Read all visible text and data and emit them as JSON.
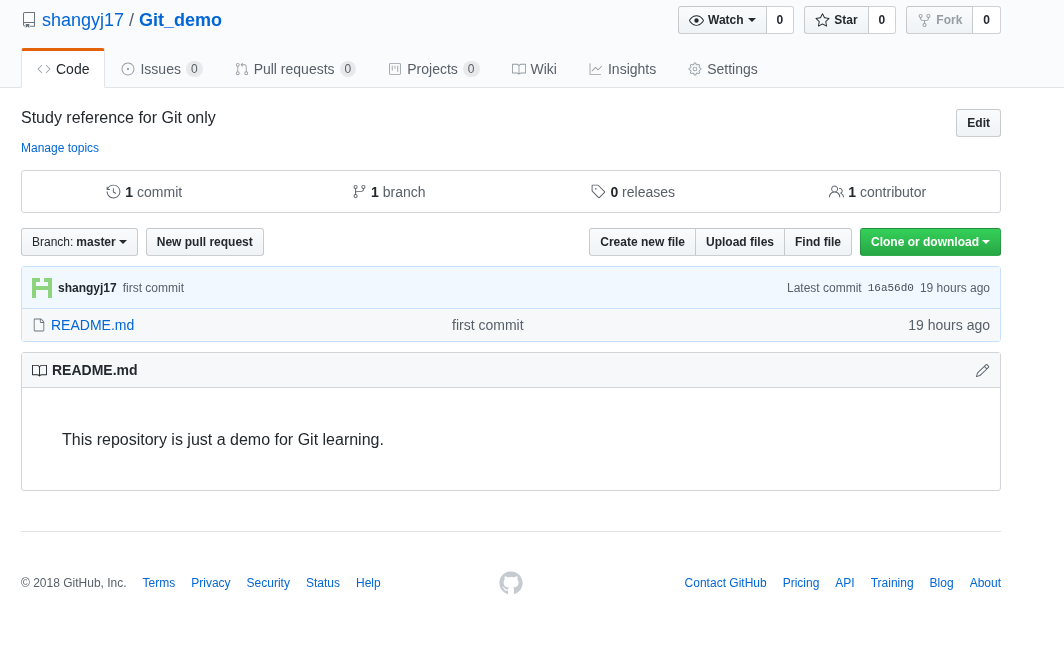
{
  "repo": {
    "owner": "shangyj17",
    "separator": "/",
    "name": "Git_demo"
  },
  "actions": [
    {
      "label": "Watch",
      "count": "0",
      "disabled": false,
      "caret": true
    },
    {
      "label": "Star",
      "count": "0",
      "disabled": false,
      "caret": false
    },
    {
      "label": "Fork",
      "count": "0",
      "disabled": true,
      "caret": false
    }
  ],
  "tabs": [
    {
      "label": "Code",
      "selected": true
    },
    {
      "label": "Issues",
      "count": "0",
      "selected": false
    },
    {
      "label": "Pull requests",
      "count": "0",
      "selected": false
    },
    {
      "label": "Projects",
      "count": "0",
      "selected": false
    },
    {
      "label": "Wiki",
      "selected": false
    },
    {
      "label": "Insights",
      "selected": false
    },
    {
      "label": "Settings",
      "selected": false
    }
  ],
  "description": "Study reference for Git only",
  "edit_button": "Edit",
  "manage_topics": "Manage topics",
  "stats": [
    "**1** commit",
    "**1** branch",
    "**0** releases",
    "**1** contributor"
  ],
  "branch_button": {
    "prefix": "Branch:",
    "branch": "master"
  },
  "new_pull_request": "New pull request",
  "file_buttons": [
    "Create new file",
    "Upload files",
    "Find file"
  ],
  "clone_button": "Clone or download",
  "commit": {
    "author": "shangyj17",
    "message": "first commit",
    "latest_label": "Latest commit",
    "sha": "16a56d0",
    "time": "19 hours ago"
  },
  "files": [
    {
      "name": "README.md",
      "message": "first commit",
      "time": "19 hours ago"
    }
  ],
  "readme": {
    "title": "README.md",
    "body": "This repository is just a demo for Git learning."
  },
  "footer": {
    "copyright": "© 2018 GitHub, Inc.",
    "left_links": [
      "Terms",
      "Privacy",
      "Security",
      "Status",
      "Help"
    ],
    "right_links": [
      "Contact GitHub",
      "Pricing",
      "API",
      "Training",
      "Blog",
      "About"
    ]
  }
}
